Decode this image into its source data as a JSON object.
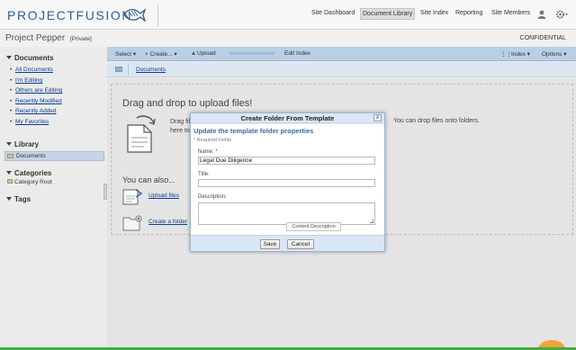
{
  "header": {
    "logo": "PROJECTFUSION",
    "nav": [
      "Site Dashboard",
      "Document Library",
      "Site Index",
      "Reporting",
      "Site Members"
    ],
    "active_nav": "Document Library"
  },
  "site": {
    "title": "Project Pepper",
    "visibility": "[Private]",
    "classification": "CONFIDENTIAL"
  },
  "sidebar": {
    "documents_heading": "Documents",
    "document_links": [
      "All Documents",
      "I'm Editing",
      "Others are Editing",
      "Recently Modified",
      "Recently Added",
      "My Favorites"
    ],
    "library_heading": "Library",
    "library_item": "Documents",
    "categories_heading": "Categories",
    "category_item": "Category Root",
    "tags_heading": "Tags"
  },
  "toolbar": {
    "select": "Select ▾",
    "create": "+ Create... ▾",
    "upload": "Upload",
    "edit_index": "Edit Index",
    "index": "Index ▾",
    "options": "Options ▾"
  },
  "breadcrumb": {
    "current": "Documents"
  },
  "dropzone": {
    "title": "Drag and drop to upload files!",
    "left_text_1": "Drag files",
    "left_text_2": "here to",
    "right_text": "You can drop files onto folders.",
    "also_heading": "You can also...",
    "upload_link": "Upload files",
    "create_folder_link": "Create a folder"
  },
  "dialog": {
    "title": "Create Folder From Template",
    "close": "x",
    "heading": "Update the template folder properties",
    "required_note": "* Required Fields",
    "name_label": "Name: *",
    "name_value": "Legal Due Diligence",
    "title_label": "Title:",
    "title_value": "",
    "description_label": "Description:",
    "tooltip": "Content Description",
    "save": "Save",
    "cancel": "Cancel"
  },
  "colors": {
    "brand": "#2f5f95",
    "toolbar": "#b9cfe4",
    "link": "#0b3d91",
    "dialog_heading": "#3a6aa4"
  }
}
